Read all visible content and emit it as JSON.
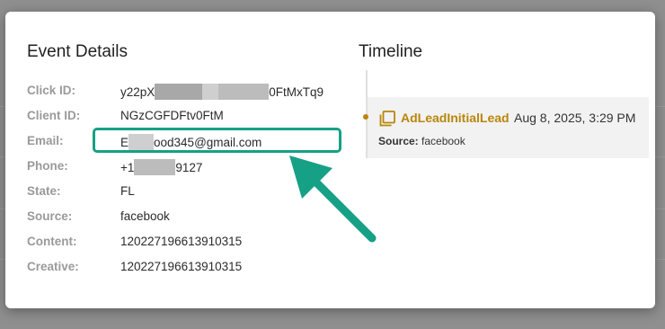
{
  "colors": {
    "overlay": "#8f8f8f",
    "highlight": "#16a085",
    "event_accent": "#b8860b",
    "label": "#9a9a9a"
  },
  "details": {
    "title": "Event Details",
    "rows": [
      {
        "label": "Click ID:",
        "value_start": "y22pX",
        "value_end": "0FtMxTq9"
      },
      {
        "label": "Client ID:",
        "value": "NGzCGFDFtv0FtM"
      },
      {
        "label": "Email:",
        "value_start": "E",
        "value_end": "ood345@gmail.com"
      },
      {
        "label": "Phone:",
        "value_start": "+1",
        "value_end": "9127"
      },
      {
        "label": "State:",
        "value": "FL"
      },
      {
        "label": "Source:",
        "value": "facebook"
      },
      {
        "label": "Content:",
        "value": "120227196613910315"
      },
      {
        "label": "Creative:",
        "value": "120227196613910315"
      }
    ]
  },
  "timeline": {
    "title": "Timeline",
    "events": [
      {
        "icon": "copy-icon",
        "name": "AdLeadInitialLead",
        "date": "Aug 8, 2025, 3:29 PM",
        "source_label": "Source:",
        "source_value": "facebook"
      }
    ]
  },
  "annotations": {
    "highlight_target": "email-row",
    "arrow_icon": "arrow-up-left-icon"
  }
}
